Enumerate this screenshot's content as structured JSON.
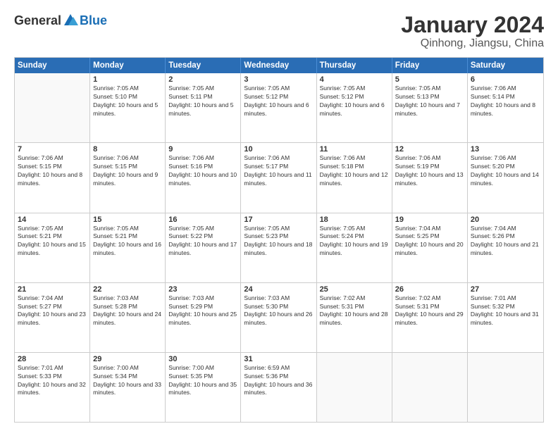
{
  "header": {
    "logo": {
      "general": "General",
      "blue": "Blue"
    },
    "title": "January 2024",
    "location": "Qinhong, Jiangsu, China"
  },
  "calendar": {
    "days_of_week": [
      "Sunday",
      "Monday",
      "Tuesday",
      "Wednesday",
      "Thursday",
      "Friday",
      "Saturday"
    ],
    "weeks": [
      [
        {
          "day": "",
          "sunrise": "",
          "sunset": "",
          "daylight": ""
        },
        {
          "day": "1",
          "sunrise": "Sunrise: 7:05 AM",
          "sunset": "Sunset: 5:10 PM",
          "daylight": "Daylight: 10 hours and 5 minutes."
        },
        {
          "day": "2",
          "sunrise": "Sunrise: 7:05 AM",
          "sunset": "Sunset: 5:11 PM",
          "daylight": "Daylight: 10 hours and 5 minutes."
        },
        {
          "day": "3",
          "sunrise": "Sunrise: 7:05 AM",
          "sunset": "Sunset: 5:12 PM",
          "daylight": "Daylight: 10 hours and 6 minutes."
        },
        {
          "day": "4",
          "sunrise": "Sunrise: 7:05 AM",
          "sunset": "Sunset: 5:12 PM",
          "daylight": "Daylight: 10 hours and 6 minutes."
        },
        {
          "day": "5",
          "sunrise": "Sunrise: 7:05 AM",
          "sunset": "Sunset: 5:13 PM",
          "daylight": "Daylight: 10 hours and 7 minutes."
        },
        {
          "day": "6",
          "sunrise": "Sunrise: 7:06 AM",
          "sunset": "Sunset: 5:14 PM",
          "daylight": "Daylight: 10 hours and 8 minutes."
        }
      ],
      [
        {
          "day": "7",
          "sunrise": "Sunrise: 7:06 AM",
          "sunset": "Sunset: 5:15 PM",
          "daylight": "Daylight: 10 hours and 8 minutes."
        },
        {
          "day": "8",
          "sunrise": "Sunrise: 7:06 AM",
          "sunset": "Sunset: 5:15 PM",
          "daylight": "Daylight: 10 hours and 9 minutes."
        },
        {
          "day": "9",
          "sunrise": "Sunrise: 7:06 AM",
          "sunset": "Sunset: 5:16 PM",
          "daylight": "Daylight: 10 hours and 10 minutes."
        },
        {
          "day": "10",
          "sunrise": "Sunrise: 7:06 AM",
          "sunset": "Sunset: 5:17 PM",
          "daylight": "Daylight: 10 hours and 11 minutes."
        },
        {
          "day": "11",
          "sunrise": "Sunrise: 7:06 AM",
          "sunset": "Sunset: 5:18 PM",
          "daylight": "Daylight: 10 hours and 12 minutes."
        },
        {
          "day": "12",
          "sunrise": "Sunrise: 7:06 AM",
          "sunset": "Sunset: 5:19 PM",
          "daylight": "Daylight: 10 hours and 13 minutes."
        },
        {
          "day": "13",
          "sunrise": "Sunrise: 7:06 AM",
          "sunset": "Sunset: 5:20 PM",
          "daylight": "Daylight: 10 hours and 14 minutes."
        }
      ],
      [
        {
          "day": "14",
          "sunrise": "Sunrise: 7:05 AM",
          "sunset": "Sunset: 5:21 PM",
          "daylight": "Daylight: 10 hours and 15 minutes."
        },
        {
          "day": "15",
          "sunrise": "Sunrise: 7:05 AM",
          "sunset": "Sunset: 5:21 PM",
          "daylight": "Daylight: 10 hours and 16 minutes."
        },
        {
          "day": "16",
          "sunrise": "Sunrise: 7:05 AM",
          "sunset": "Sunset: 5:22 PM",
          "daylight": "Daylight: 10 hours and 17 minutes."
        },
        {
          "day": "17",
          "sunrise": "Sunrise: 7:05 AM",
          "sunset": "Sunset: 5:23 PM",
          "daylight": "Daylight: 10 hours and 18 minutes."
        },
        {
          "day": "18",
          "sunrise": "Sunrise: 7:05 AM",
          "sunset": "Sunset: 5:24 PM",
          "daylight": "Daylight: 10 hours and 19 minutes."
        },
        {
          "day": "19",
          "sunrise": "Sunrise: 7:04 AM",
          "sunset": "Sunset: 5:25 PM",
          "daylight": "Daylight: 10 hours and 20 minutes."
        },
        {
          "day": "20",
          "sunrise": "Sunrise: 7:04 AM",
          "sunset": "Sunset: 5:26 PM",
          "daylight": "Daylight: 10 hours and 21 minutes."
        }
      ],
      [
        {
          "day": "21",
          "sunrise": "Sunrise: 7:04 AM",
          "sunset": "Sunset: 5:27 PM",
          "daylight": "Daylight: 10 hours and 23 minutes."
        },
        {
          "day": "22",
          "sunrise": "Sunrise: 7:03 AM",
          "sunset": "Sunset: 5:28 PM",
          "daylight": "Daylight: 10 hours and 24 minutes."
        },
        {
          "day": "23",
          "sunrise": "Sunrise: 7:03 AM",
          "sunset": "Sunset: 5:29 PM",
          "daylight": "Daylight: 10 hours and 25 minutes."
        },
        {
          "day": "24",
          "sunrise": "Sunrise: 7:03 AM",
          "sunset": "Sunset: 5:30 PM",
          "daylight": "Daylight: 10 hours and 26 minutes."
        },
        {
          "day": "25",
          "sunrise": "Sunrise: 7:02 AM",
          "sunset": "Sunset: 5:31 PM",
          "daylight": "Daylight: 10 hours and 28 minutes."
        },
        {
          "day": "26",
          "sunrise": "Sunrise: 7:02 AM",
          "sunset": "Sunset: 5:31 PM",
          "daylight": "Daylight: 10 hours and 29 minutes."
        },
        {
          "day": "27",
          "sunrise": "Sunrise: 7:01 AM",
          "sunset": "Sunset: 5:32 PM",
          "daylight": "Daylight: 10 hours and 31 minutes."
        }
      ],
      [
        {
          "day": "28",
          "sunrise": "Sunrise: 7:01 AM",
          "sunset": "Sunset: 5:33 PM",
          "daylight": "Daylight: 10 hours and 32 minutes."
        },
        {
          "day": "29",
          "sunrise": "Sunrise: 7:00 AM",
          "sunset": "Sunset: 5:34 PM",
          "daylight": "Daylight: 10 hours and 33 minutes."
        },
        {
          "day": "30",
          "sunrise": "Sunrise: 7:00 AM",
          "sunset": "Sunset: 5:35 PM",
          "daylight": "Daylight: 10 hours and 35 minutes."
        },
        {
          "day": "31",
          "sunrise": "Sunrise: 6:59 AM",
          "sunset": "Sunset: 5:36 PM",
          "daylight": "Daylight: 10 hours and 36 minutes."
        },
        {
          "day": "",
          "sunrise": "",
          "sunset": "",
          "daylight": ""
        },
        {
          "day": "",
          "sunrise": "",
          "sunset": "",
          "daylight": ""
        },
        {
          "day": "",
          "sunrise": "",
          "sunset": "",
          "daylight": ""
        }
      ]
    ]
  }
}
